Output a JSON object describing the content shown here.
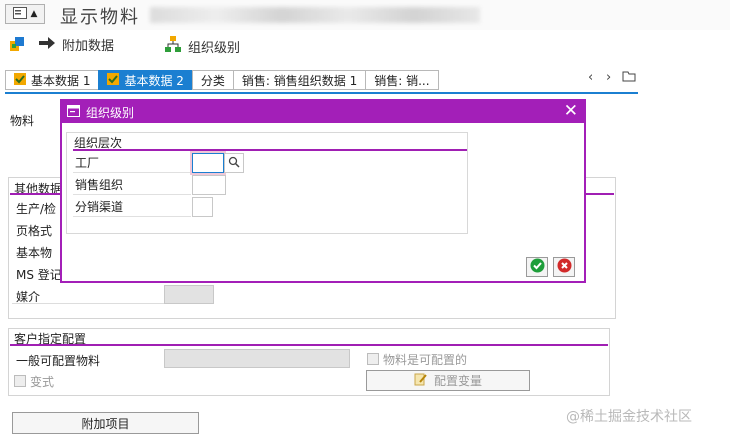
{
  "header": {
    "title": "显示物料"
  },
  "toolbar": {
    "additional_data": "附加数据",
    "org_levels": "组织级别"
  },
  "tabs": [
    {
      "label": "基本数据 1"
    },
    {
      "label": "基本数据 2"
    },
    {
      "label": "分类"
    },
    {
      "label": "销售: 销售组织数据 1"
    },
    {
      "label": "销售: 销..."
    }
  ],
  "main": {
    "material_label": "物料",
    "other_data": {
      "title": "其他数据",
      "rows": [
        "生产/检",
        "页格式",
        "基本物",
        "MS 登记"
      ],
      "media_label": "媒介"
    },
    "customer_config": {
      "title": "客户指定配置",
      "general_configurable_label": "一般可配置物料",
      "is_configurable_label": "物料是可配置的",
      "variant_label": "变式",
      "config_variant_button": "配置变量"
    },
    "additional_items_button": "附加项目"
  },
  "dialog": {
    "title": "组织级别",
    "group_title": "组织层次",
    "fields": [
      {
        "label": "工厂",
        "value": ""
      },
      {
        "label": "销售组织",
        "value": ""
      },
      {
        "label": "分销渠道",
        "value": ""
      }
    ]
  },
  "watermark": "@稀土掘金技术社区",
  "colors": {
    "accent": "#a31fb8",
    "tab_active": "#1b7fd1",
    "ok": "#1e9e3a",
    "cancel": "#d22a2a"
  }
}
